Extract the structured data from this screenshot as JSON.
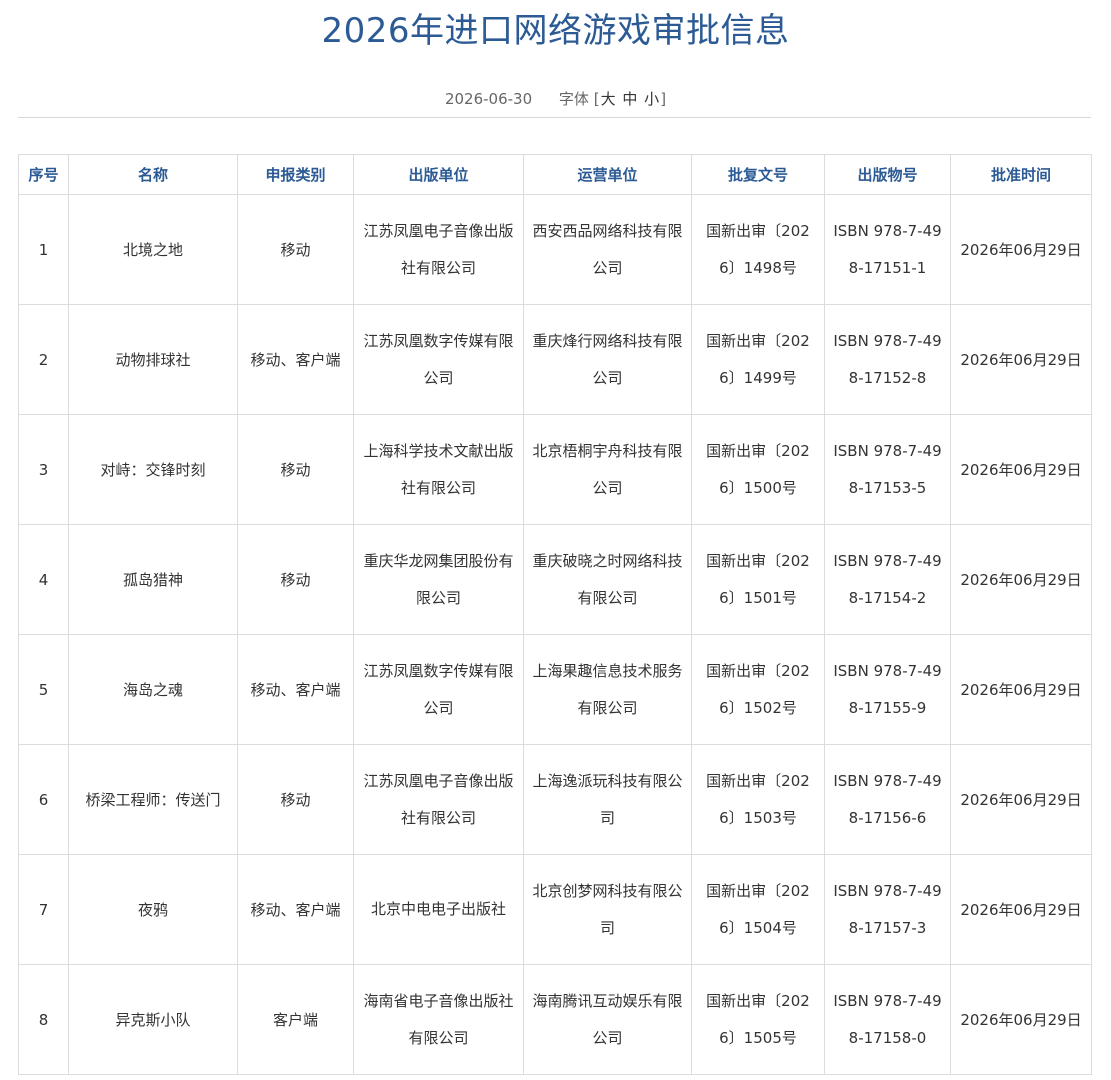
{
  "page": {
    "title": "2026年进口网络游戏审批信息",
    "date": "2026-06-30",
    "font_size_label": "字体",
    "bracket_open": "[",
    "bracket_close": "]",
    "size_large": "大",
    "size_medium": "中",
    "size_small": "小"
  },
  "colors": {
    "title": "#2c5a94",
    "header_text": "#2c5a94",
    "border": "#dcdcdc"
  },
  "table": {
    "headers": [
      "序号",
      "名称",
      "申报类别",
      "出版单位",
      "运营单位",
      "批复文号",
      "出版物号",
      "批准时间"
    ],
    "rows": [
      {
        "index": "1",
        "name": "北境之地",
        "type": "移动",
        "publisher": "江苏凤凰电子音像出版社有限公司",
        "operator": "西安西品网络科技有限公司",
        "approval_no": "国新出审〔2026〕1498号",
        "isbn": "ISBN 978-7-498-17151-1",
        "date": "2026年06月29日"
      },
      {
        "index": "2",
        "name": "动物排球社",
        "type": "移动、客户端",
        "publisher": "江苏凤凰数字传媒有限公司",
        "operator": "重庆烽行网络科技有限公司",
        "approval_no": "国新出审〔2026〕1499号",
        "isbn": "ISBN 978-7-498-17152-8",
        "date": "2026年06月29日"
      },
      {
        "index": "3",
        "name": "对峙：交锋时刻",
        "type": "移动",
        "publisher": "上海科学技术文献出版社有限公司",
        "operator": "北京梧桐宇舟科技有限公司",
        "approval_no": "国新出审〔2026〕1500号",
        "isbn": "ISBN 978-7-498-17153-5",
        "date": "2026年06月29日"
      },
      {
        "index": "4",
        "name": "孤岛猎神",
        "type": "移动",
        "publisher": "重庆华龙网集团股份有限公司",
        "operator": "重庆破晓之时网络科技有限公司",
        "approval_no": "国新出审〔2026〕1501号",
        "isbn": "ISBN 978-7-498-17154-2",
        "date": "2026年06月29日"
      },
      {
        "index": "5",
        "name": "海岛之魂",
        "type": "移动、客户端",
        "publisher": "江苏凤凰数字传媒有限公司",
        "operator": "上海果趣信息技术服务有限公司",
        "approval_no": "国新出审〔2026〕1502号",
        "isbn": "ISBN 978-7-498-17155-9",
        "date": "2026年06月29日"
      },
      {
        "index": "6",
        "name": "桥梁工程师：传送门",
        "type": "移动",
        "publisher": "江苏凤凰电子音像出版社有限公司",
        "operator": "上海逸派玩科技有限公司",
        "approval_no": "国新出审〔2026〕1503号",
        "isbn": "ISBN 978-7-498-17156-6",
        "date": "2026年06月29日"
      },
      {
        "index": "7",
        "name": "夜鸦",
        "type": "移动、客户端",
        "publisher": "北京中电电子出版社",
        "operator": "北京创梦网科技有限公司",
        "approval_no": "国新出审〔2026〕1504号",
        "isbn": "ISBN 978-7-498-17157-3",
        "date": "2026年06月29日"
      },
      {
        "index": "8",
        "name": "异克斯小队",
        "type": "客户端",
        "publisher": "海南省电子音像出版社有限公司",
        "operator": "海南腾讯互动娱乐有限公司",
        "approval_no": "国新出审〔2026〕1505号",
        "isbn": "ISBN 978-7-498-17158-0",
        "date": "2026年06月29日"
      }
    ]
  }
}
